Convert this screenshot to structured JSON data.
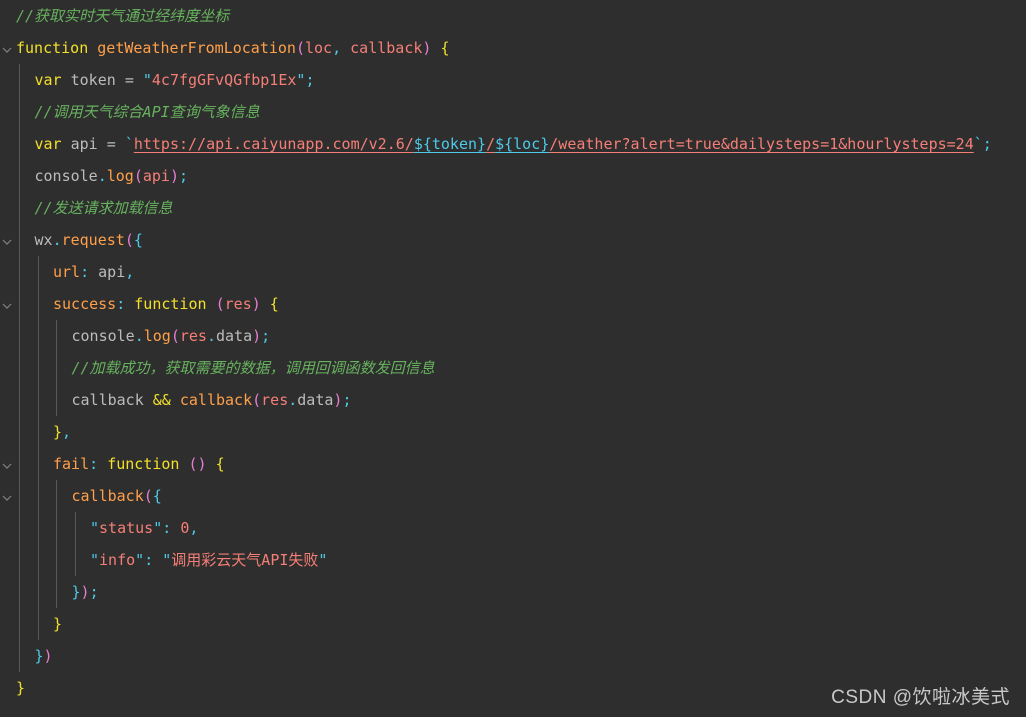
{
  "editor": {
    "background": "#2e2e2e",
    "font_size_px": 15,
    "line_height_px": 32,
    "language": "javascript",
    "theme_colors": {
      "comment": "#67b25e",
      "keyword": "#f2e02a",
      "function": "#ffa04a",
      "string": "#f57f77",
      "punctuation": "#4ec9e8",
      "paren": "#e67fd4",
      "plain": "#bcbcbc",
      "indent_guide": "#585858"
    }
  },
  "watermark": {
    "text": "CSDN @饮啦冰美式"
  },
  "code": {
    "lines": [
      {
        "n": 1,
        "indent": 0,
        "foldable": false,
        "text": "//获取实时天气通过经纬度坐标"
      },
      {
        "n": 2,
        "indent": 0,
        "foldable": true,
        "text": "function getWeatherFromLocation(loc, callback) {"
      },
      {
        "n": 3,
        "indent": 1,
        "foldable": false,
        "text": "var token = \"4c7fgGFvQGfbp1Ex\";"
      },
      {
        "n": 4,
        "indent": 1,
        "foldable": false,
        "text": "//调用天气综合API查询气象信息"
      },
      {
        "n": 5,
        "indent": 1,
        "foldable": false,
        "text": "var api = `https://api.caiyunapp.com/v2.6/${token}/${loc}/weather?alert=true&dailysteps=1&hourlysteps=24`;"
      },
      {
        "n": 6,
        "indent": 1,
        "foldable": false,
        "text": "console.log(api);"
      },
      {
        "n": 7,
        "indent": 1,
        "foldable": false,
        "text": "//发送请求加载信息"
      },
      {
        "n": 8,
        "indent": 1,
        "foldable": true,
        "text": "wx.request({"
      },
      {
        "n": 9,
        "indent": 2,
        "foldable": false,
        "text": "url: api,"
      },
      {
        "n": 10,
        "indent": 2,
        "foldable": true,
        "text": "success: function (res) {"
      },
      {
        "n": 11,
        "indent": 3,
        "foldable": false,
        "text": "console.log(res.data);"
      },
      {
        "n": 12,
        "indent": 3,
        "foldable": false,
        "text": "//加载成功，获取需要的数据，调用回调函数发回信息"
      },
      {
        "n": 13,
        "indent": 3,
        "foldable": false,
        "text": "callback && callback(res.data);"
      },
      {
        "n": 14,
        "indent": 2,
        "foldable": false,
        "text": "},"
      },
      {
        "n": 15,
        "indent": 2,
        "foldable": true,
        "text": "fail: function () {"
      },
      {
        "n": 16,
        "indent": 3,
        "foldable": true,
        "text": "callback({"
      },
      {
        "n": 17,
        "indent": 4,
        "foldable": false,
        "text": "\"status\": 0,"
      },
      {
        "n": 18,
        "indent": 4,
        "foldable": false,
        "text": "\"info\": \"调用彩云天气API失败\""
      },
      {
        "n": 19,
        "indent": 3,
        "foldable": false,
        "text": "});"
      },
      {
        "n": 20,
        "indent": 2,
        "foldable": false,
        "text": "}"
      },
      {
        "n": 21,
        "indent": 1,
        "foldable": false,
        "text": "})"
      },
      {
        "n": 22,
        "indent": 0,
        "foldable": false,
        "text": "}"
      }
    ]
  }
}
